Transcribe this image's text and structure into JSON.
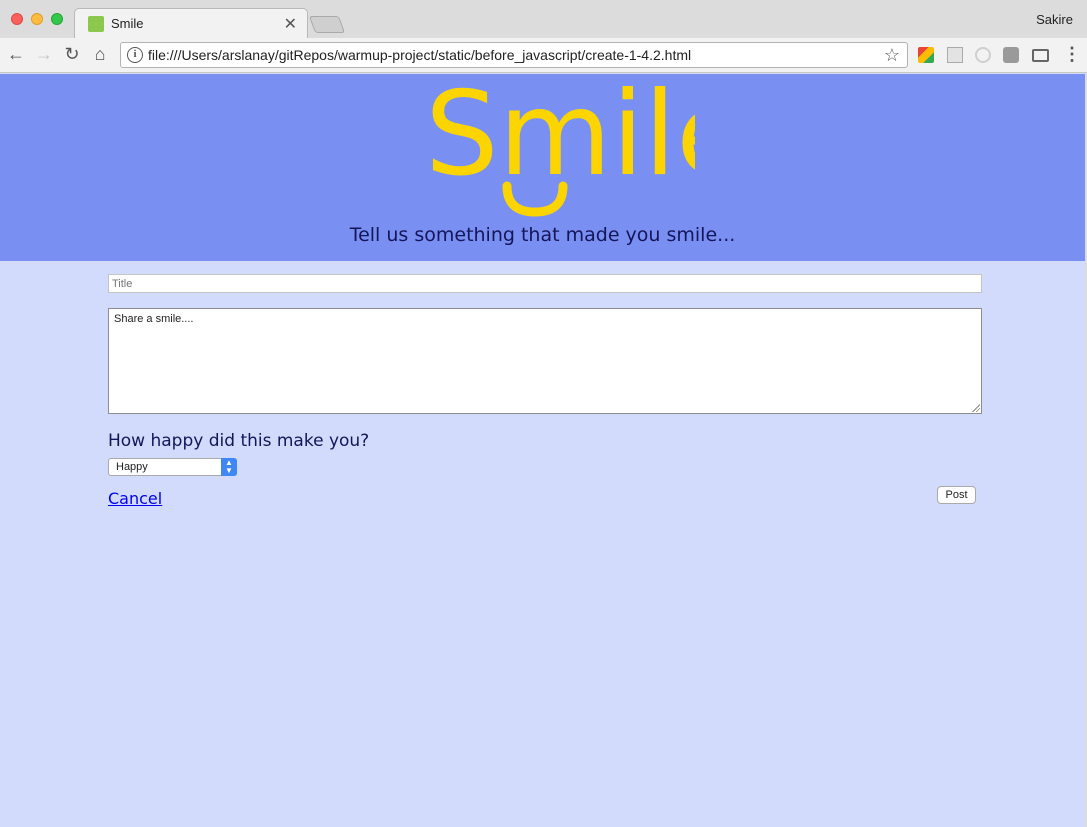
{
  "browser": {
    "tab_title": "Smile",
    "profile_name": "Sakire",
    "url": "file:///Users/arslanay/gitRepos/warmup-project/static/before_javascript/create-1-4.2.html"
  },
  "page": {
    "logo_text": "Smile",
    "tagline": "Tell us something that made you smile...",
    "title_placeholder": "Title",
    "body_value": "Share a smile....",
    "question": "How happy did this make you?",
    "happiness_selected": "Happy",
    "cancel_label": "Cancel",
    "post_label": "Post"
  },
  "colors": {
    "banner": "#7a8ff2",
    "page_background": "#d2dbfb",
    "logo": "#fcd500",
    "text": "#14165a",
    "link": "#0000ee"
  }
}
